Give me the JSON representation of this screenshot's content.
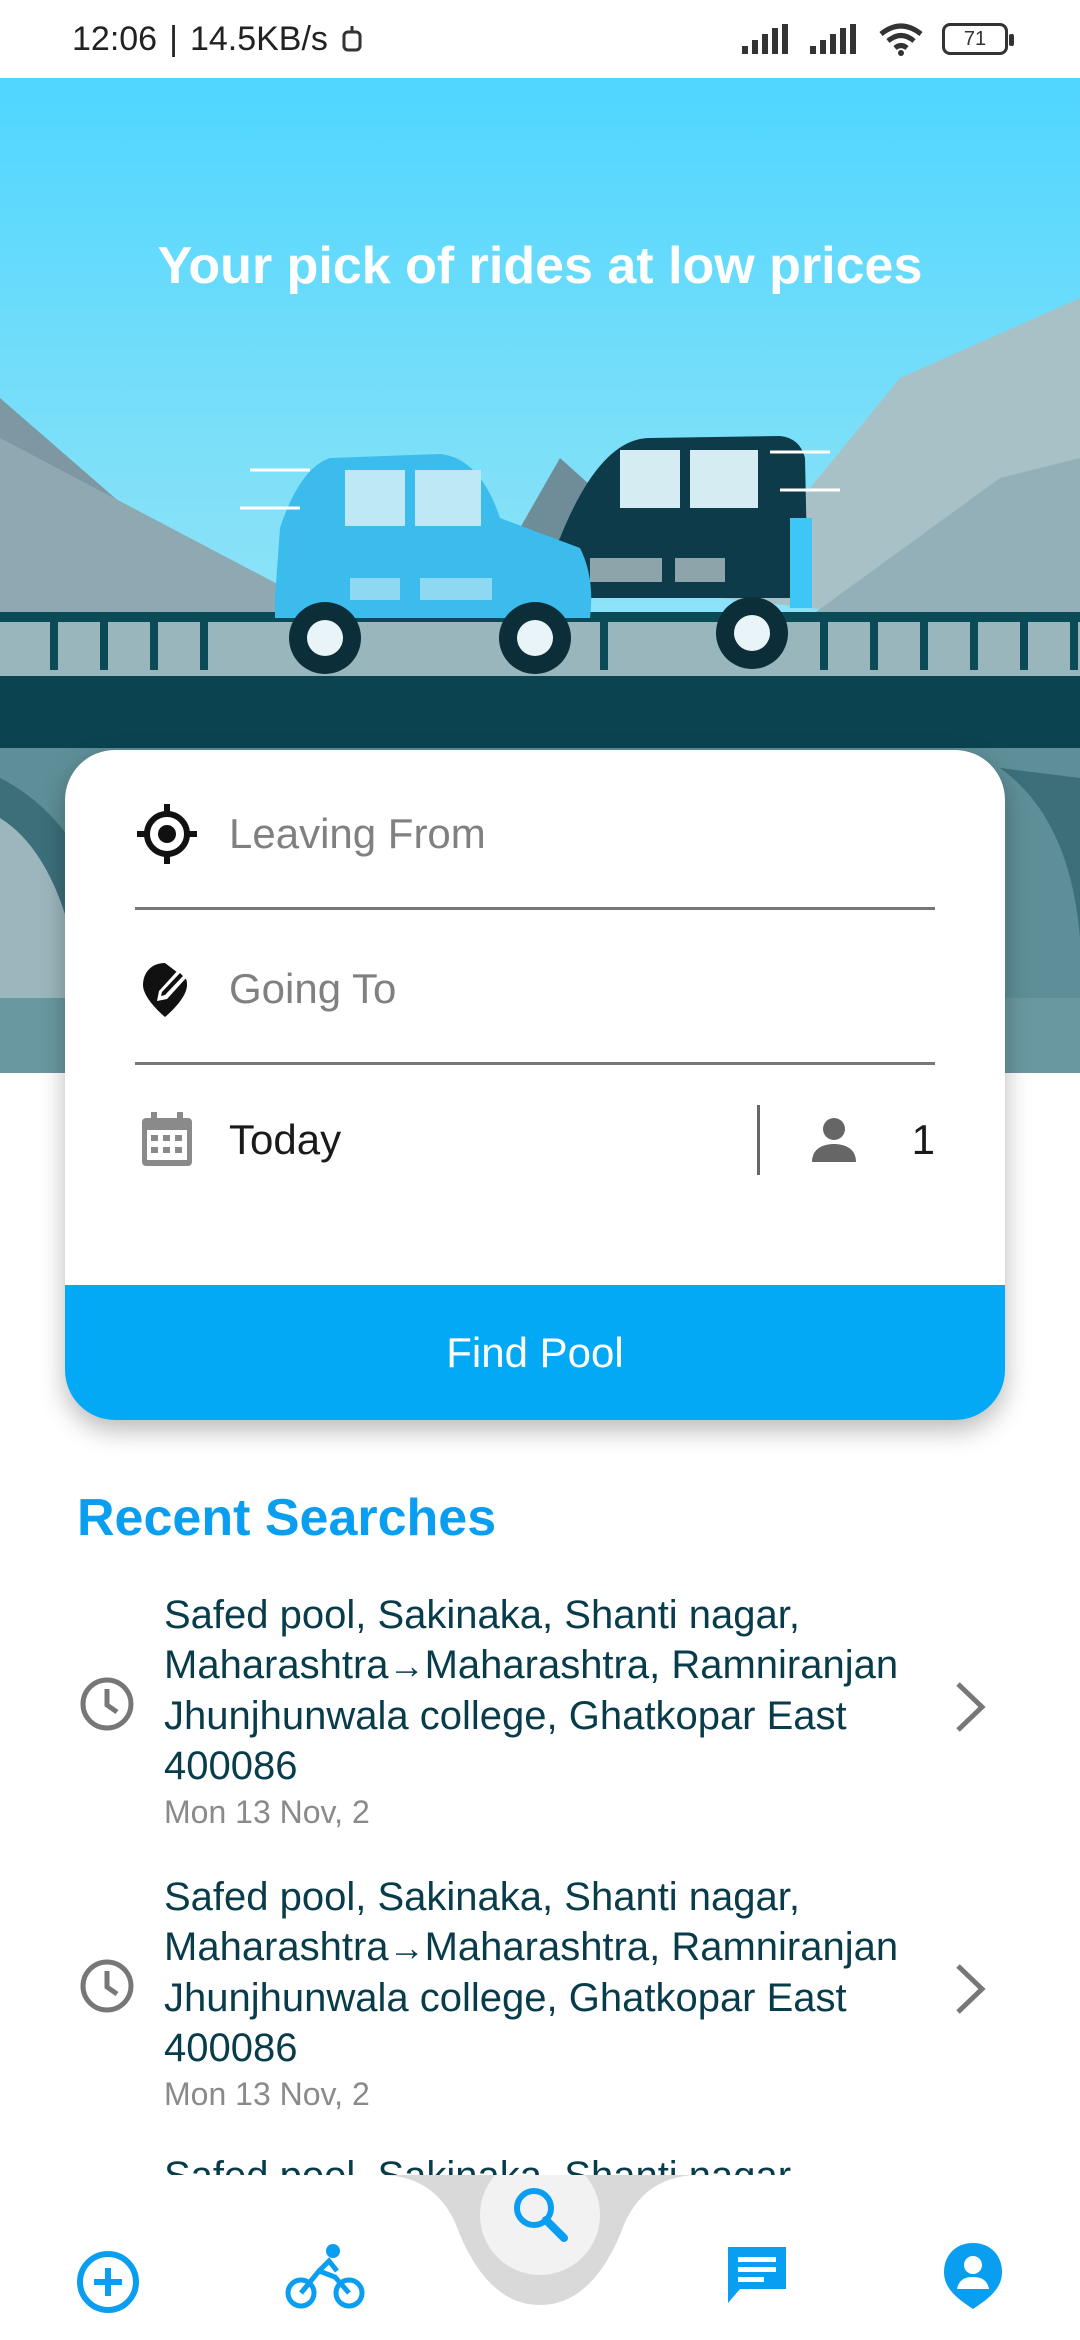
{
  "status_bar": {
    "time": "12:06",
    "net_speed": "14.5KB/s",
    "battery": "71"
  },
  "hero": {
    "title": "Your pick of rides at low prices"
  },
  "search": {
    "from_placeholder": "Leaving From",
    "to_placeholder": "Going To",
    "date": "Today",
    "passengers": "1",
    "button": "Find Pool"
  },
  "recent": {
    "title": "Recent Searches",
    "items": [
      {
        "from": "Safed pool, Sakinaka, Shanti nagar, Maharashtra",
        "to": "Maharashtra, Ramniranjan Jhunjhunwala college, Ghatkopar East 400086",
        "date": "Mon 13 Nov, 2"
      },
      {
        "from": "Safed pool, Sakinaka, Shanti nagar, Maharashtra",
        "to": "Maharashtra, Ramniranjan Jhunjhunwala college, Ghatkopar East 400086",
        "date": "Mon 13 Nov, 2"
      }
    ],
    "partial_item": "Safed pool, Sakinaka, Shanti nagar"
  },
  "nav": {
    "icons": [
      "add-circle-icon",
      "cyclist-icon",
      "search-icon",
      "chat-icon",
      "profile-icon"
    ],
    "accent": "#0a9ef0"
  },
  "colors": {
    "primary": "#03a9f4",
    "heading": "#0a9ef0",
    "route_text": "#083c4b"
  }
}
